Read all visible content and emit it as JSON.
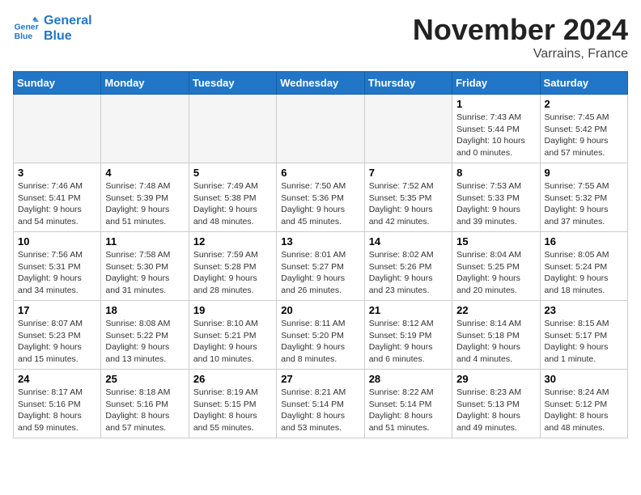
{
  "logo": {
    "line1": "General",
    "line2": "Blue"
  },
  "title": "November 2024",
  "location": "Varrains, France",
  "days_of_week": [
    "Sunday",
    "Monday",
    "Tuesday",
    "Wednesday",
    "Thursday",
    "Friday",
    "Saturday"
  ],
  "weeks": [
    [
      {
        "day": "",
        "detail": "",
        "empty": true
      },
      {
        "day": "",
        "detail": "",
        "empty": true
      },
      {
        "day": "",
        "detail": "",
        "empty": true
      },
      {
        "day": "",
        "detail": "",
        "empty": true
      },
      {
        "day": "",
        "detail": "",
        "empty": true
      },
      {
        "day": "1",
        "detail": "Sunrise: 7:43 AM\nSunset: 5:44 PM\nDaylight: 10 hours\nand 0 minutes.",
        "empty": false
      },
      {
        "day": "2",
        "detail": "Sunrise: 7:45 AM\nSunset: 5:42 PM\nDaylight: 9 hours\nand 57 minutes.",
        "empty": false
      }
    ],
    [
      {
        "day": "3",
        "detail": "Sunrise: 7:46 AM\nSunset: 5:41 PM\nDaylight: 9 hours\nand 54 minutes.",
        "empty": false
      },
      {
        "day": "4",
        "detail": "Sunrise: 7:48 AM\nSunset: 5:39 PM\nDaylight: 9 hours\nand 51 minutes.",
        "empty": false
      },
      {
        "day": "5",
        "detail": "Sunrise: 7:49 AM\nSunset: 5:38 PM\nDaylight: 9 hours\nand 48 minutes.",
        "empty": false
      },
      {
        "day": "6",
        "detail": "Sunrise: 7:50 AM\nSunset: 5:36 PM\nDaylight: 9 hours\nand 45 minutes.",
        "empty": false
      },
      {
        "day": "7",
        "detail": "Sunrise: 7:52 AM\nSunset: 5:35 PM\nDaylight: 9 hours\nand 42 minutes.",
        "empty": false
      },
      {
        "day": "8",
        "detail": "Sunrise: 7:53 AM\nSunset: 5:33 PM\nDaylight: 9 hours\nand 39 minutes.",
        "empty": false
      },
      {
        "day": "9",
        "detail": "Sunrise: 7:55 AM\nSunset: 5:32 PM\nDaylight: 9 hours\nand 37 minutes.",
        "empty": false
      }
    ],
    [
      {
        "day": "10",
        "detail": "Sunrise: 7:56 AM\nSunset: 5:31 PM\nDaylight: 9 hours\nand 34 minutes.",
        "empty": false
      },
      {
        "day": "11",
        "detail": "Sunrise: 7:58 AM\nSunset: 5:30 PM\nDaylight: 9 hours\nand 31 minutes.",
        "empty": false
      },
      {
        "day": "12",
        "detail": "Sunrise: 7:59 AM\nSunset: 5:28 PM\nDaylight: 9 hours\nand 28 minutes.",
        "empty": false
      },
      {
        "day": "13",
        "detail": "Sunrise: 8:01 AM\nSunset: 5:27 PM\nDaylight: 9 hours\nand 26 minutes.",
        "empty": false
      },
      {
        "day": "14",
        "detail": "Sunrise: 8:02 AM\nSunset: 5:26 PM\nDaylight: 9 hours\nand 23 minutes.",
        "empty": false
      },
      {
        "day": "15",
        "detail": "Sunrise: 8:04 AM\nSunset: 5:25 PM\nDaylight: 9 hours\nand 20 minutes.",
        "empty": false
      },
      {
        "day": "16",
        "detail": "Sunrise: 8:05 AM\nSunset: 5:24 PM\nDaylight: 9 hours\nand 18 minutes.",
        "empty": false
      }
    ],
    [
      {
        "day": "17",
        "detail": "Sunrise: 8:07 AM\nSunset: 5:23 PM\nDaylight: 9 hours\nand 15 minutes.",
        "empty": false
      },
      {
        "day": "18",
        "detail": "Sunrise: 8:08 AM\nSunset: 5:22 PM\nDaylight: 9 hours\nand 13 minutes.",
        "empty": false
      },
      {
        "day": "19",
        "detail": "Sunrise: 8:10 AM\nSunset: 5:21 PM\nDaylight: 9 hours\nand 10 minutes.",
        "empty": false
      },
      {
        "day": "20",
        "detail": "Sunrise: 8:11 AM\nSunset: 5:20 PM\nDaylight: 9 hours\nand 8 minutes.",
        "empty": false
      },
      {
        "day": "21",
        "detail": "Sunrise: 8:12 AM\nSunset: 5:19 PM\nDaylight: 9 hours\nand 6 minutes.",
        "empty": false
      },
      {
        "day": "22",
        "detail": "Sunrise: 8:14 AM\nSunset: 5:18 PM\nDaylight: 9 hours\nand 4 minutes.",
        "empty": false
      },
      {
        "day": "23",
        "detail": "Sunrise: 8:15 AM\nSunset: 5:17 PM\nDaylight: 9 hours\nand 1 minute.",
        "empty": false
      }
    ],
    [
      {
        "day": "24",
        "detail": "Sunrise: 8:17 AM\nSunset: 5:16 PM\nDaylight: 8 hours\nand 59 minutes.",
        "empty": false
      },
      {
        "day": "25",
        "detail": "Sunrise: 8:18 AM\nSunset: 5:16 PM\nDaylight: 8 hours\nand 57 minutes.",
        "empty": false
      },
      {
        "day": "26",
        "detail": "Sunrise: 8:19 AM\nSunset: 5:15 PM\nDaylight: 8 hours\nand 55 minutes.",
        "empty": false
      },
      {
        "day": "27",
        "detail": "Sunrise: 8:21 AM\nSunset: 5:14 PM\nDaylight: 8 hours\nand 53 minutes.",
        "empty": false
      },
      {
        "day": "28",
        "detail": "Sunrise: 8:22 AM\nSunset: 5:14 PM\nDaylight: 8 hours\nand 51 minutes.",
        "empty": false
      },
      {
        "day": "29",
        "detail": "Sunrise: 8:23 AM\nSunset: 5:13 PM\nDaylight: 8 hours\nand 49 minutes.",
        "empty": false
      },
      {
        "day": "30",
        "detail": "Sunrise: 8:24 AM\nSunset: 5:12 PM\nDaylight: 8 hours\nand 48 minutes.",
        "empty": false
      }
    ]
  ]
}
